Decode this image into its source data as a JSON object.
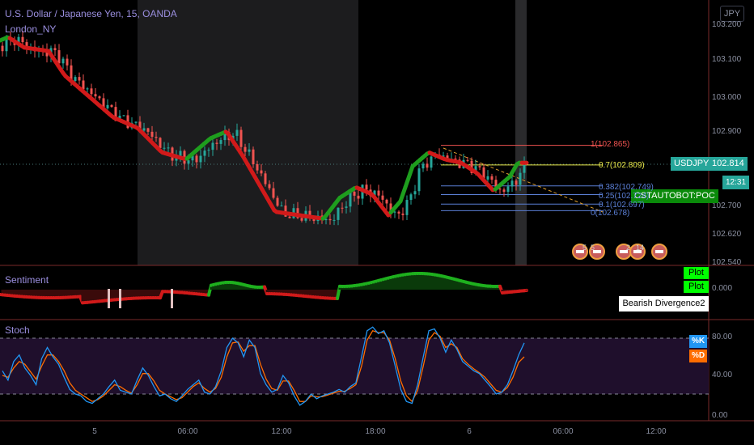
{
  "header": {
    "title": "U.S. Dollar / Japanese Yen, 15, OANDA",
    "indicator": "London_NY",
    "currency": "JPY"
  },
  "chart_data": {
    "type": "candlestick",
    "symbol": "USDJPY",
    "y_ticks": [
      "103.200",
      "103.100",
      "103.000",
      "102.900",
      "102.700",
      "102.620",
      "102.540"
    ],
    "y_tick_values": [
      103.2,
      103.1,
      103.0,
      102.9,
      102.7,
      102.62,
      102.54
    ],
    "x_ticks": [
      "5",
      "06:00",
      "12:00",
      "18:00",
      "6",
      "06:00",
      "12:00"
    ],
    "last_price": {
      "symbol": "USDJPY",
      "value": "102.814",
      "countdown": "12:31"
    },
    "fib_levels": [
      {
        "label": "1(102.865)",
        "value": 102.865,
        "color": "#ef5350"
      },
      {
        "label": "0.7(102.809)",
        "value": 102.809,
        "color": "#e8e84a"
      },
      {
        "label": "0.382(102.749)",
        "value": 102.749,
        "color": "#5b7fd6"
      },
      {
        "label": "0.25(102.724)",
        "value": 102.724,
        "color": "#5b7fd6"
      },
      {
        "label": "0.1(102.697)",
        "value": 102.697,
        "color": "#5b7fd6"
      },
      {
        "label": "0(102.678)",
        "value": 102.678,
        "color": "#5b7fd6"
      }
    ],
    "poc_label": "CSTAUTOBOT:POC",
    "badges": [
      "5",
      "5",
      "2",
      "14"
    ],
    "sentiment": {
      "label": "Sentiment",
      "y_ticks": [
        "0.000"
      ],
      "plots": [
        "Plot",
        "Plot"
      ],
      "annotation": "Bearish Divergence2"
    },
    "stoch": {
      "label": "Stoch",
      "y_ticks": [
        "80.00",
        "40.00",
        "0.00"
      ],
      "y_tick_values": [
        80,
        40,
        0
      ],
      "legend": [
        "%K",
        "%D"
      ],
      "colors": {
        "k": "#2196f3",
        "d": "#ff6d00"
      },
      "k_values": [
        45,
        35,
        55,
        62,
        48,
        40,
        30,
        58,
        70,
        60,
        52,
        38,
        25,
        20,
        18,
        12,
        10,
        15,
        20,
        28,
        35,
        24,
        22,
        20,
        35,
        48,
        40,
        28,
        18,
        20,
        15,
        12,
        18,
        25,
        30,
        35,
        22,
        20,
        28,
        45,
        70,
        80,
        75,
        60,
        78,
        70,
        42,
        30,
        22,
        25,
        40,
        32,
        18,
        8,
        12,
        20,
        15,
        18,
        20,
        22,
        25,
        22,
        28,
        32,
        60,
        88,
        92,
        85,
        88,
        75,
        50,
        25,
        12,
        10,
        30,
        60,
        88,
        90,
        80,
        65,
        78,
        68,
        55,
        50,
        45,
        42,
        35,
        28,
        20,
        22,
        30,
        45,
        62,
        75
      ],
      "d_values": [
        40,
        38,
        48,
        55,
        52,
        44,
        36,
        50,
        62,
        62,
        55,
        45,
        32,
        24,
        20,
        16,
        12,
        14,
        18,
        24,
        30,
        28,
        24,
        21,
        30,
        42,
        42,
        34,
        24,
        20,
        17,
        14,
        16,
        22,
        28,
        32,
        26,
        22,
        26,
        38,
        60,
        75,
        76,
        66,
        72,
        72,
        52,
        36,
        26,
        24,
        34,
        34,
        24,
        12,
        12,
        18,
        17,
        17,
        19,
        21,
        23,
        23,
        26,
        30,
        50,
        78,
        88,
        86,
        86,
        78,
        58,
        34,
        18,
        12,
        24,
        50,
        78,
        86,
        82,
        70,
        74,
        70,
        58,
        52,
        47,
        43,
        38,
        31,
        24,
        22,
        27,
        38,
        54,
        60
      ]
    }
  }
}
